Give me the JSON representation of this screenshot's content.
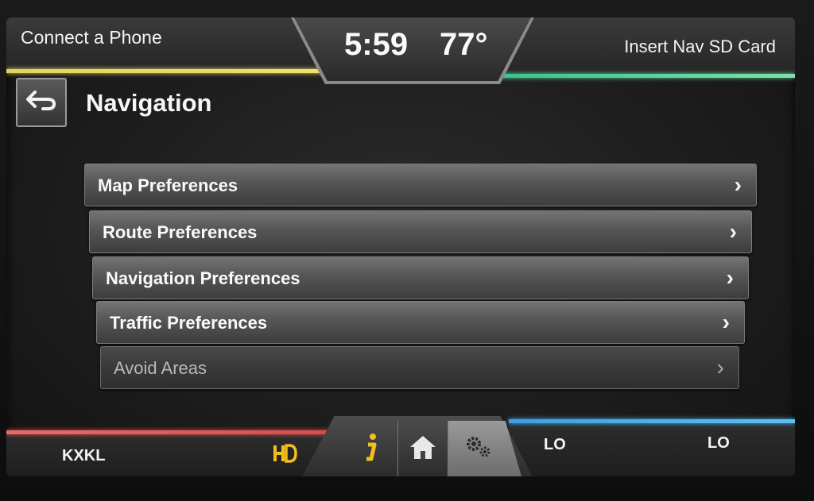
{
  "status_bar": {
    "left_text": "Connect a Phone",
    "time": "5:59",
    "temperature": "77°",
    "right_text": "Insert Nav SD Card"
  },
  "header": {
    "title": "Navigation",
    "back_icon": "back-arrow-icon"
  },
  "menu": {
    "items": [
      {
        "label": "Map Preferences",
        "enabled": true
      },
      {
        "label": "Route Preferences",
        "enabled": true
      },
      {
        "label": "Navigation Preferences",
        "enabled": true
      },
      {
        "label": "Traffic Preferences",
        "enabled": true
      },
      {
        "label": "Avoid Areas",
        "enabled": false
      }
    ],
    "chevron": "›"
  },
  "bottom_bar": {
    "station": "KXKL",
    "hd_icon": "hd-radio-icon",
    "tabs": [
      {
        "name": "info",
        "icon": "info-icon"
      },
      {
        "name": "home",
        "icon": "home-icon"
      },
      {
        "name": "settings",
        "icon": "gears-icon",
        "active": true
      }
    ],
    "climate_left": "LO",
    "climate_right": "LO"
  },
  "colors": {
    "top_left_accent": "#e8de6a",
    "top_right_accent": "#55d49a",
    "bottom_left_accent": "#e05050",
    "bottom_right_accent": "#4ab4ef",
    "info_icon": "#f0c020",
    "hd_icon": "#f0c020"
  }
}
